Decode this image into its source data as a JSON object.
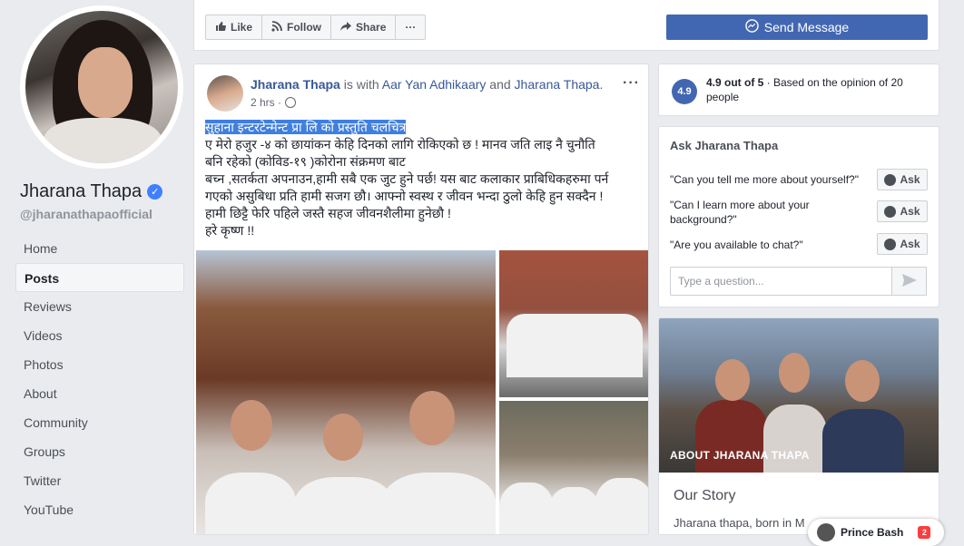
{
  "profile": {
    "name": "Jharana Thapa",
    "handle": "@jharanathapaofficial"
  },
  "nav": [
    "Home",
    "Posts",
    "Reviews",
    "Videos",
    "Photos",
    "About",
    "Community",
    "Groups",
    "Twitter",
    "YouTube"
  ],
  "nav_active": "Posts",
  "actions": {
    "like": "Like",
    "follow": "Follow",
    "share": "Share",
    "more": "···",
    "send_message": "Send Message"
  },
  "post": {
    "author": "Jharana Thapa",
    "with_text": " is with ",
    "tagged1": "Aar Yan Adhikaary",
    "and_text": " and ",
    "tagged2": "Jharana Thapa",
    "period": ".",
    "time": "2 hrs ·",
    "more": "···",
    "text_selected": "सुहाना इन्टरटेन्मेन्ट प्रा लि को प्रस्तुति चलचित्र",
    "text_lines": [
      "ए मेरो हजुर -४ को छायांकन केहि दिनको लागि रोकिएको छ ! मानव जति लाइ नै चुनौति",
      "बनि रहेको (कोविड-१९ )कोरोना संक्रमण बाट",
      "बच्न ,सतर्कता अपनाउन,हामी सबै एक जुट हुने पर्छ! यस बाट कलाकार प्राबिधिकहरुमा पर्न",
      "गएको असुबिधा प्रति हामी सजग छौ। आफ्नो स्वस्थ र जीवन भन्दा ठुलो केहि हुन सक्दैन !",
      "हामी छिट्टै फेरि पहिले जस्तै सहज जीवनशैलीमा हुनेछौ !",
      "हरे कृष्ण !!"
    ]
  },
  "rating": {
    "badge": "4.9",
    "score_text": "4.9 out of 5",
    "detail": " · Based on the opinion of 20 people"
  },
  "ask": {
    "title": "Ask Jharana Thapa",
    "questions": [
      "\"Can you tell me more about yourself?\"",
      "\"Can I learn more about your background?\"",
      "\"Are you available to chat?\""
    ],
    "button_label": "Ask",
    "input_placeholder": "Type a question..."
  },
  "about": {
    "label": "ABOUT JHARANA THAPA",
    "story_title": "Our Story",
    "story_text": "Jharana thapa, born in M"
  },
  "chat": {
    "name": "Prince Bash",
    "count": "2"
  },
  "colors": {
    "brand": "#4267b2",
    "link": "#385898",
    "selection": "#3f7fe0"
  }
}
